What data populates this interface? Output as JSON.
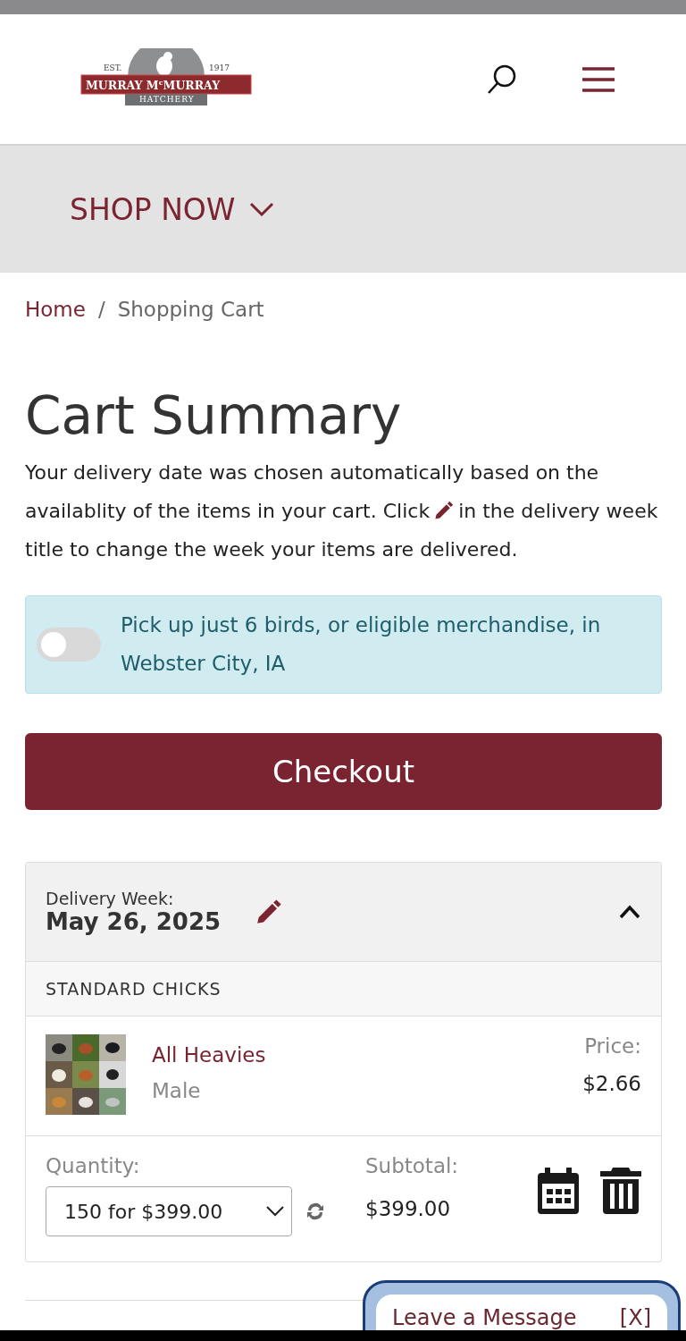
{
  "logo": {
    "est": "EST.",
    "year": "1917",
    "name": "MURRAY M$^{c}$MURRAY",
    "sub": "HATCHERY"
  },
  "shop_menu": {
    "label": "SHOP NOW",
    "expanded": false
  },
  "breadcrumb": [
    {
      "label": "Home",
      "link": true
    },
    {
      "label": "Shopping Cart",
      "link": false
    }
  ],
  "separator": "/",
  "title": "Cart Summary",
  "intro_before": "Your delivery date was chosen automatically based on the availablity of the items in your cart. Click",
  "intro_after": "in the delivery week title to change the week your items are delivered.",
  "pickup": {
    "label": "Pick up just 6 birds, or eligible merchandise, in Webster City, IA",
    "on": false
  },
  "checkout": "Checkout",
  "delivery": {
    "label": "Delivery Week:",
    "date": "May 26, 2025",
    "expanded": true,
    "category": "STANDARD CHICKS",
    "items": [
      {
        "name": "All Heavies",
        "variant": "Male",
        "price_label": "Price:",
        "price": "$2.66",
        "quantity_label": "Quantity:",
        "quantity": "150 for $399.00",
        "subtotal_label": "Subtotal:",
        "subtotal": "$399.00"
      }
    ]
  },
  "chat": {
    "label": "Leave a Message",
    "close": "[X]"
  }
}
